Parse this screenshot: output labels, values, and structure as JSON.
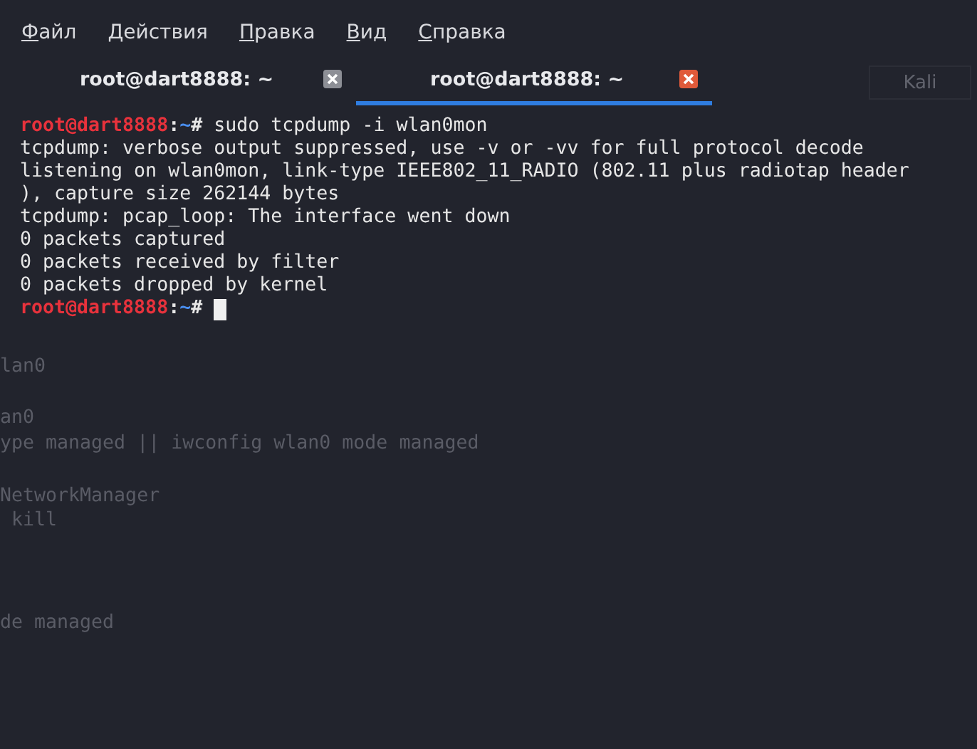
{
  "menu": [
    "Файл",
    "Действия",
    "Правка",
    "Вид",
    "Справка"
  ],
  "tabs": [
    {
      "label": "root@dart8888: ~",
      "selected": false
    },
    {
      "label": "root@dart8888: ~",
      "selected": true
    }
  ],
  "terminal": [
    {
      "kind": "prompt",
      "user": "root@dart8888",
      "separator": ":",
      "path": "~",
      "sign": "#",
      "command": "sudo tcpdump -i wlan0mon"
    },
    {
      "kind": "output",
      "text": "tcpdump: verbose output suppressed, use -v or -vv for full protocol decode"
    },
    {
      "kind": "output",
      "text": "listening on wlan0mon, link-type IEEE802_11_RADIO (802.11 plus radiotap header"
    },
    {
      "kind": "output",
      "text": "), capture size 262144 bytes"
    },
    {
      "kind": "output",
      "text": "tcpdump: pcap_loop: The interface went down"
    },
    {
      "kind": "output",
      "text": "0 packets captured"
    },
    {
      "kind": "output",
      "text": "0 packets received by filter"
    },
    {
      "kind": "output",
      "text": "0 packets dropped by kernel"
    },
    {
      "kind": "prompt",
      "user": "root@dart8888",
      "separator": ":",
      "path": "~",
      "sign": "#",
      "cursor": true
    }
  ],
  "background_window": {
    "label": "Kali",
    "lines": [
      "lan0",
      "an0",
      "ype managed || iwconfig wlan0 mode managed",
      "NetworkManager",
      " kill",
      "de managed"
    ]
  }
}
